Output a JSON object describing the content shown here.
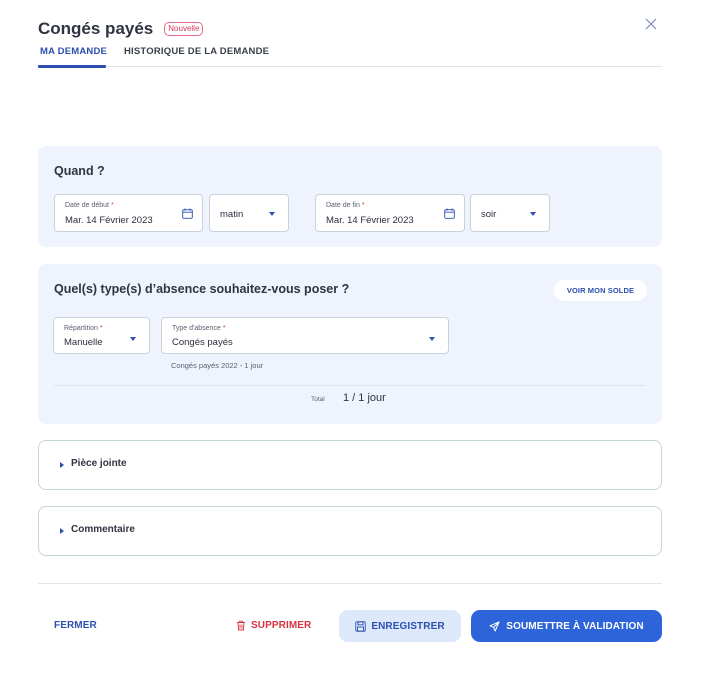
{
  "header": {
    "title": "Congés payés",
    "badge": "Nouvelle",
    "close_icon": "close-icon"
  },
  "tabs": [
    {
      "label": "MA DEMANDE",
      "active": true
    },
    {
      "label": "HISTORIQUE DE LA DEMANDE",
      "active": false
    }
  ],
  "when": {
    "title": "Quand ?",
    "start_date": {
      "label": "Date de début",
      "value": "Mar. 14 Février 2023"
    },
    "start_period": {
      "value": "matin"
    },
    "end_date": {
      "label": "Date de fin",
      "value": "Mar. 14 Février 2023"
    },
    "end_period": {
      "value": "soir"
    },
    "required_mark": "*"
  },
  "absence": {
    "title": "Quel(s) type(s) d’absence souhaitez-vous poser ?",
    "balance_button": "VOIR MON SOLDE",
    "repartition": {
      "label": "Répartition",
      "value": "Manuelle"
    },
    "absence_type": {
      "label": "Type d'absence",
      "value": "Congés payés"
    },
    "hint": "Congés payés 2022 - 1 jour",
    "total_label": "Total",
    "total_value": "1 / 1 jour"
  },
  "sections": {
    "attachment": "Pièce jointe",
    "comment": "Commentaire"
  },
  "footer": {
    "close_label": "FERMER",
    "delete_label": "SUPPRIMER",
    "save_label": "ENREGISTRER",
    "submit_label": "SOUMETTRE À VALIDATION"
  },
  "colors": {
    "accent": "#2c4fb0",
    "primary_button": "#2e64d9",
    "danger": "#d8323f",
    "card_background": "#eef3fd"
  }
}
